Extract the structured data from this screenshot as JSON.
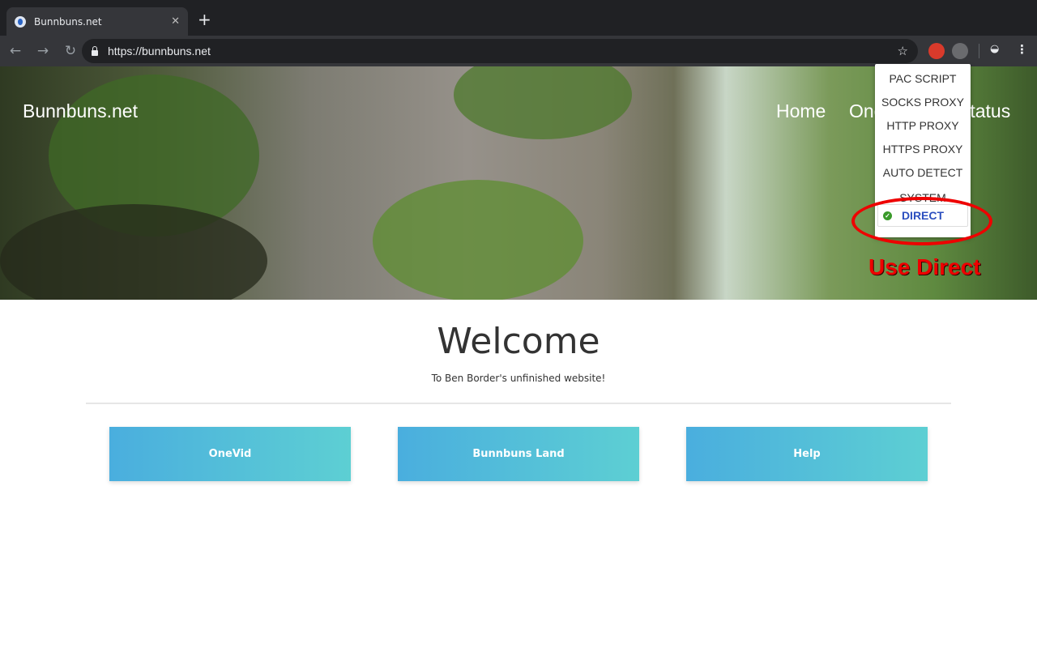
{
  "browser": {
    "tab_title": "Bunnbuns.net",
    "url": "https://bunnbuns.net"
  },
  "site": {
    "brand": "Bunnbuns.net",
    "nav": [
      "Home",
      "OneVid",
      "Status"
    ],
    "welcome": "Welcome",
    "subtitle": "To Ben Border's unfinished website!",
    "cards": [
      "OneVid",
      "Bunnbuns Land",
      "Help"
    ]
  },
  "proxy_menu": {
    "items": [
      "PAC SCRIPT",
      "SOCKS PROXY",
      "HTTP PROXY",
      "HTTPS PROXY",
      "AUTO DETECT",
      "SYSTEM"
    ],
    "selected": "DIRECT"
  },
  "annotation": {
    "text": "Use Direct",
    "color": "#e00000"
  },
  "colors": {
    "card_gradient_start": "#4aaede",
    "card_gradient_end": "#5dcfd3",
    "selected_item": "#2c4fbf"
  }
}
